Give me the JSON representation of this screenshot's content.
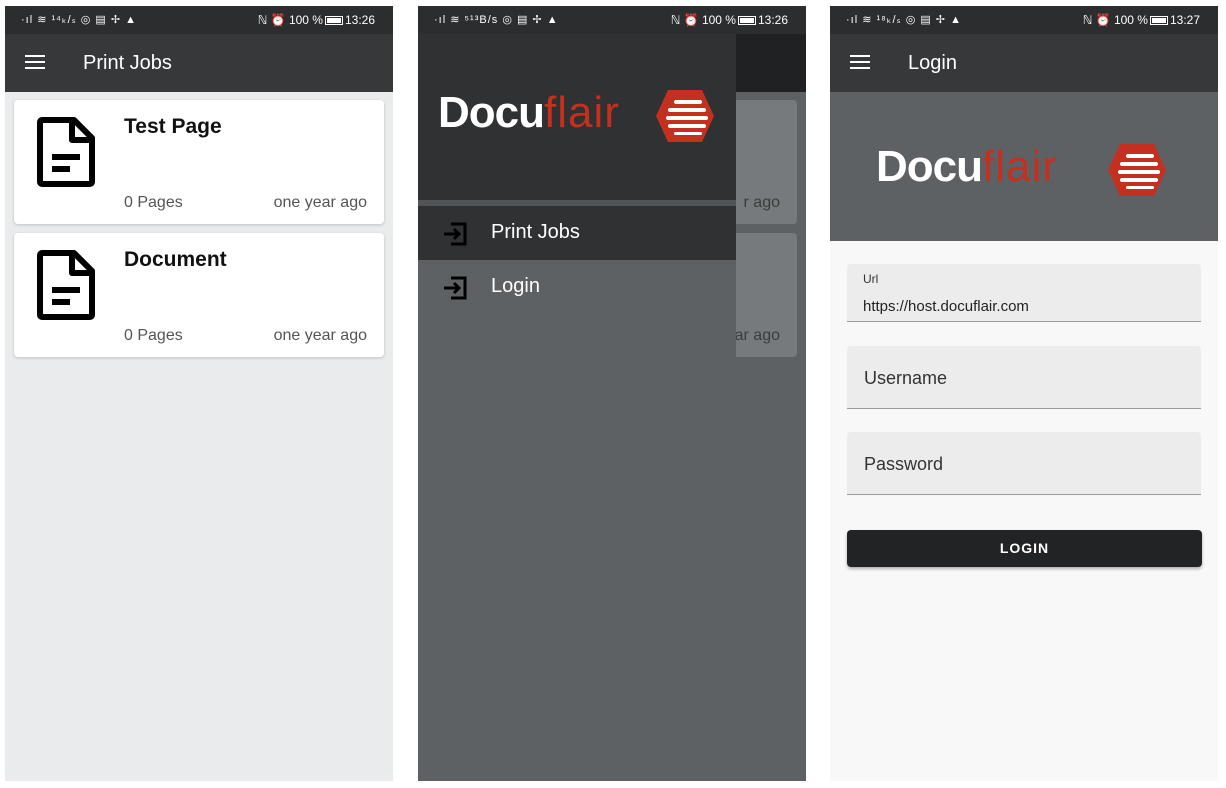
{
  "screens": [
    {
      "status": {
        "left": "·ıl ≋ ¹⁴ₖ/ₛ ◎ ▤ ✢ ▲",
        "right": "ℕ ⏰ 100 %",
        "time": "13:26"
      },
      "appbar_title": "Print Jobs",
      "jobs": [
        {
          "title": "Test Page",
          "pages": "0 Pages",
          "time": "one year ago"
        },
        {
          "title": "Document",
          "pages": "0 Pages",
          "time": "one year ago"
        }
      ]
    },
    {
      "status": {
        "left": "·ıl ≋ ⁵¹³B/s ◎ ▤ ✢ ▲",
        "right": "ℕ ⏰ 100 %",
        "time": "13:26"
      },
      "logo": {
        "part1": "Docu",
        "part2": "flair"
      },
      "behind_times": [
        "r ago",
        "ar ago"
      ],
      "menu": [
        {
          "label": "Print Jobs"
        },
        {
          "label": "Login"
        }
      ]
    },
    {
      "status": {
        "left": "·ıl ≋ ¹⁸ₖ/ₛ ◎ ▤ ✢ ▲",
        "right": "ℕ ⏰ 100 %",
        "time": "13:27"
      },
      "appbar_title": "Login",
      "logo": {
        "part1": "Docu",
        "part2": "flair"
      },
      "url": {
        "label": "Url",
        "value": "https://host.docuflair.com"
      },
      "username_placeholder": "Username",
      "password_placeholder": "Password",
      "login_button": "LOGIN"
    }
  ],
  "colors": {
    "brand_red": "#c4301f",
    "appbar": "#363839",
    "drawer": "#5e6163"
  },
  "icons": [
    "hamburger-icon",
    "document-icon",
    "login-arrow-icon",
    "docuflair-logo-icon"
  ]
}
